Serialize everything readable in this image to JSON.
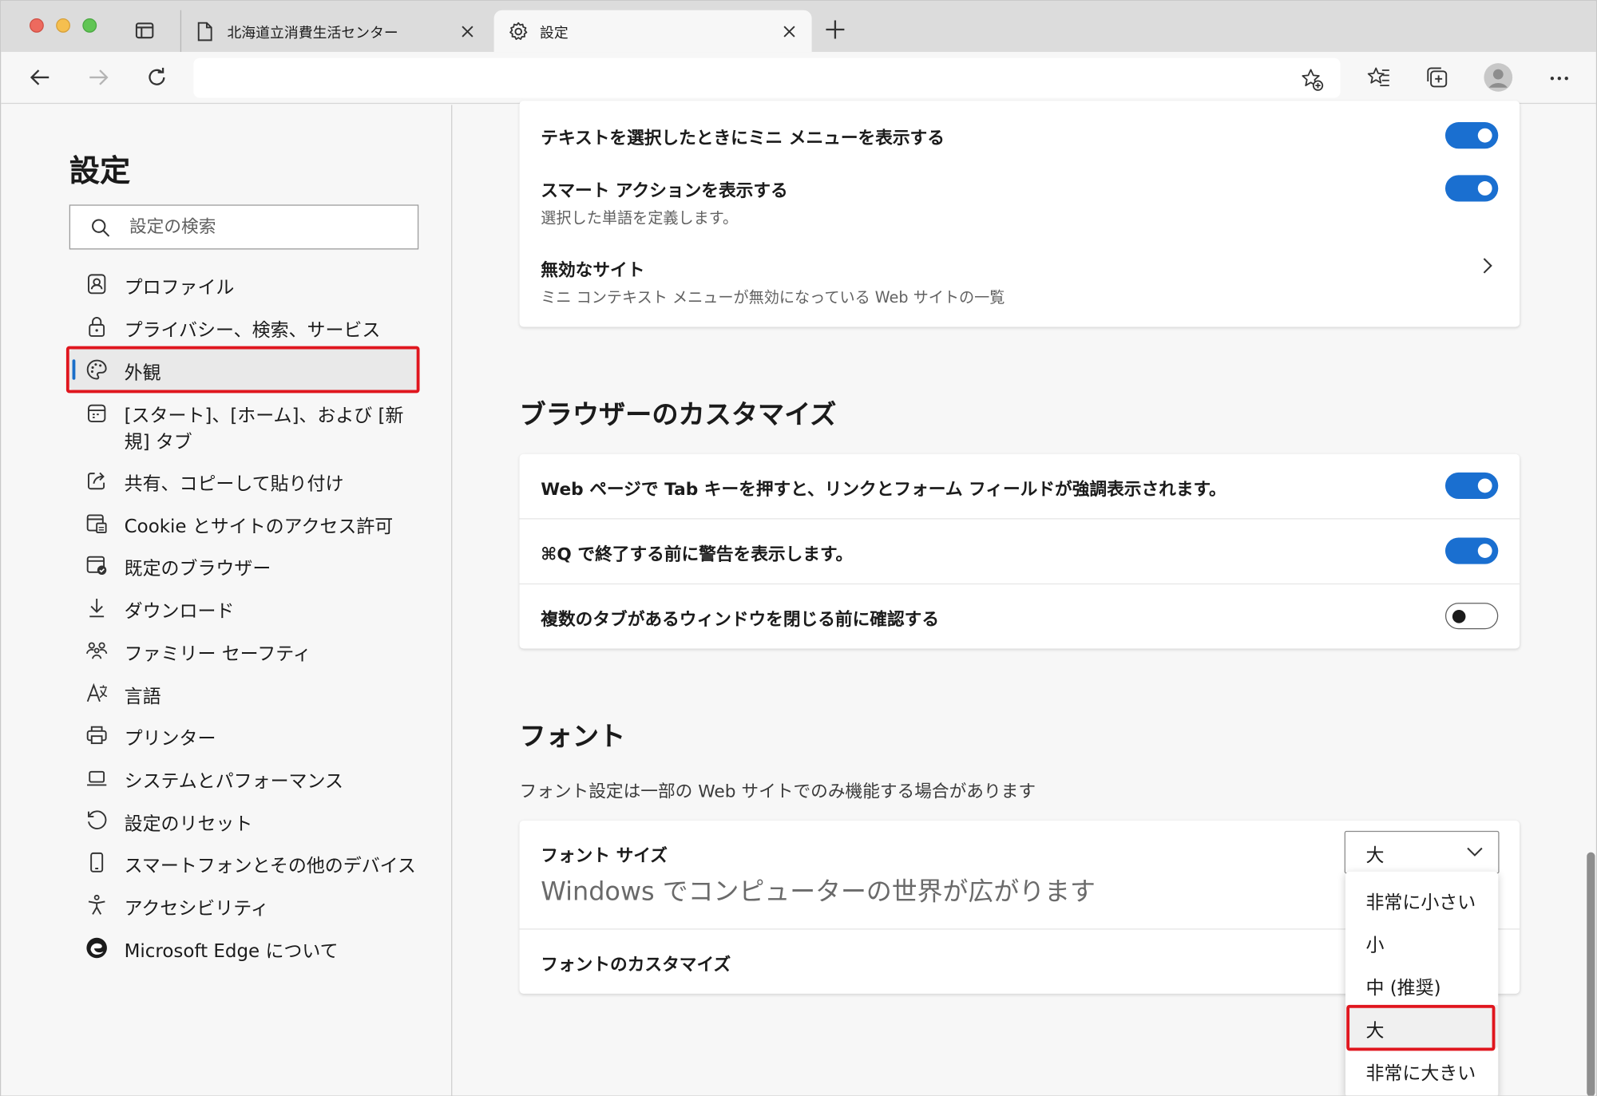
{
  "tabs": [
    {
      "title": "北海道立消費生活センター"
    },
    {
      "title": "設定"
    }
  ],
  "sidebar": {
    "title": "設定",
    "search_placeholder": "設定の検索",
    "items": [
      {
        "label": "プロファイル",
        "icon": "profile-icon"
      },
      {
        "label": "プライバシー、検索、サービス",
        "icon": "lock-icon"
      },
      {
        "label": "外観",
        "icon": "palette-icon",
        "active": true
      },
      {
        "label": "[スタート]、[ホーム]、および [新規] タブ",
        "icon": "start-home-icon"
      },
      {
        "label": "共有、コピーして貼り付け",
        "icon": "share-icon"
      },
      {
        "label": "Cookie とサイトのアクセス許可",
        "icon": "site-permissions-icon"
      },
      {
        "label": "既定のブラウザー",
        "icon": "default-browser-icon"
      },
      {
        "label": "ダウンロード",
        "icon": "download-icon"
      },
      {
        "label": "ファミリー セーフティ",
        "icon": "family-icon"
      },
      {
        "label": "言語",
        "icon": "language-icon"
      },
      {
        "label": "プリンター",
        "icon": "printer-icon"
      },
      {
        "label": "システムとパフォーマンス",
        "icon": "laptop-icon"
      },
      {
        "label": "設定のリセット",
        "icon": "reset-icon"
      },
      {
        "label": "スマートフォンとその他のデバイス",
        "icon": "phone-icon"
      },
      {
        "label": "アクセシビリティ",
        "icon": "accessibility-icon"
      },
      {
        "label": "Microsoft Edge について",
        "icon": "edge-logo-icon"
      }
    ]
  },
  "context_menu_card": {
    "rows": [
      {
        "title": "テキストを選択したときにミニ メニューを表示する",
        "toggle": "on"
      },
      {
        "title": "スマート アクションを表示する",
        "subtitle": "選択した単語を定義します。",
        "toggle": "on"
      },
      {
        "title": "無効なサイト",
        "subtitle": "ミニ コンテキスト メニューが無効になっている Web サイトの一覧"
      }
    ]
  },
  "browser_customize": {
    "heading": "ブラウザーのカスタマイズ",
    "rows": [
      {
        "title": "Web ページで Tab キーを押すと、リンクとフォーム フィールドが強調表示されます。",
        "toggle": "on"
      },
      {
        "title": "⌘Q で終了する前に警告を表示します。",
        "toggle": "on"
      },
      {
        "title": "複数のタブがあるウィンドウを閉じる前に確認する",
        "toggle": "off"
      }
    ]
  },
  "fonts": {
    "heading": "フォント",
    "description": "フォント設定は一部の Web サイトでのみ機能する場合があります",
    "font_size_label": "フォント サイズ",
    "preview_text": "Windows でコンピューターの世界が広がります",
    "selected_size": "大",
    "customize_label": "フォントのカスタマイズ",
    "size_options": [
      "非常に小さい",
      "小",
      "中 (推奨)",
      "大",
      "非常に大きい"
    ]
  },
  "colors": {
    "accent": "#1a6fd0",
    "highlight_box": "#e0161e"
  }
}
